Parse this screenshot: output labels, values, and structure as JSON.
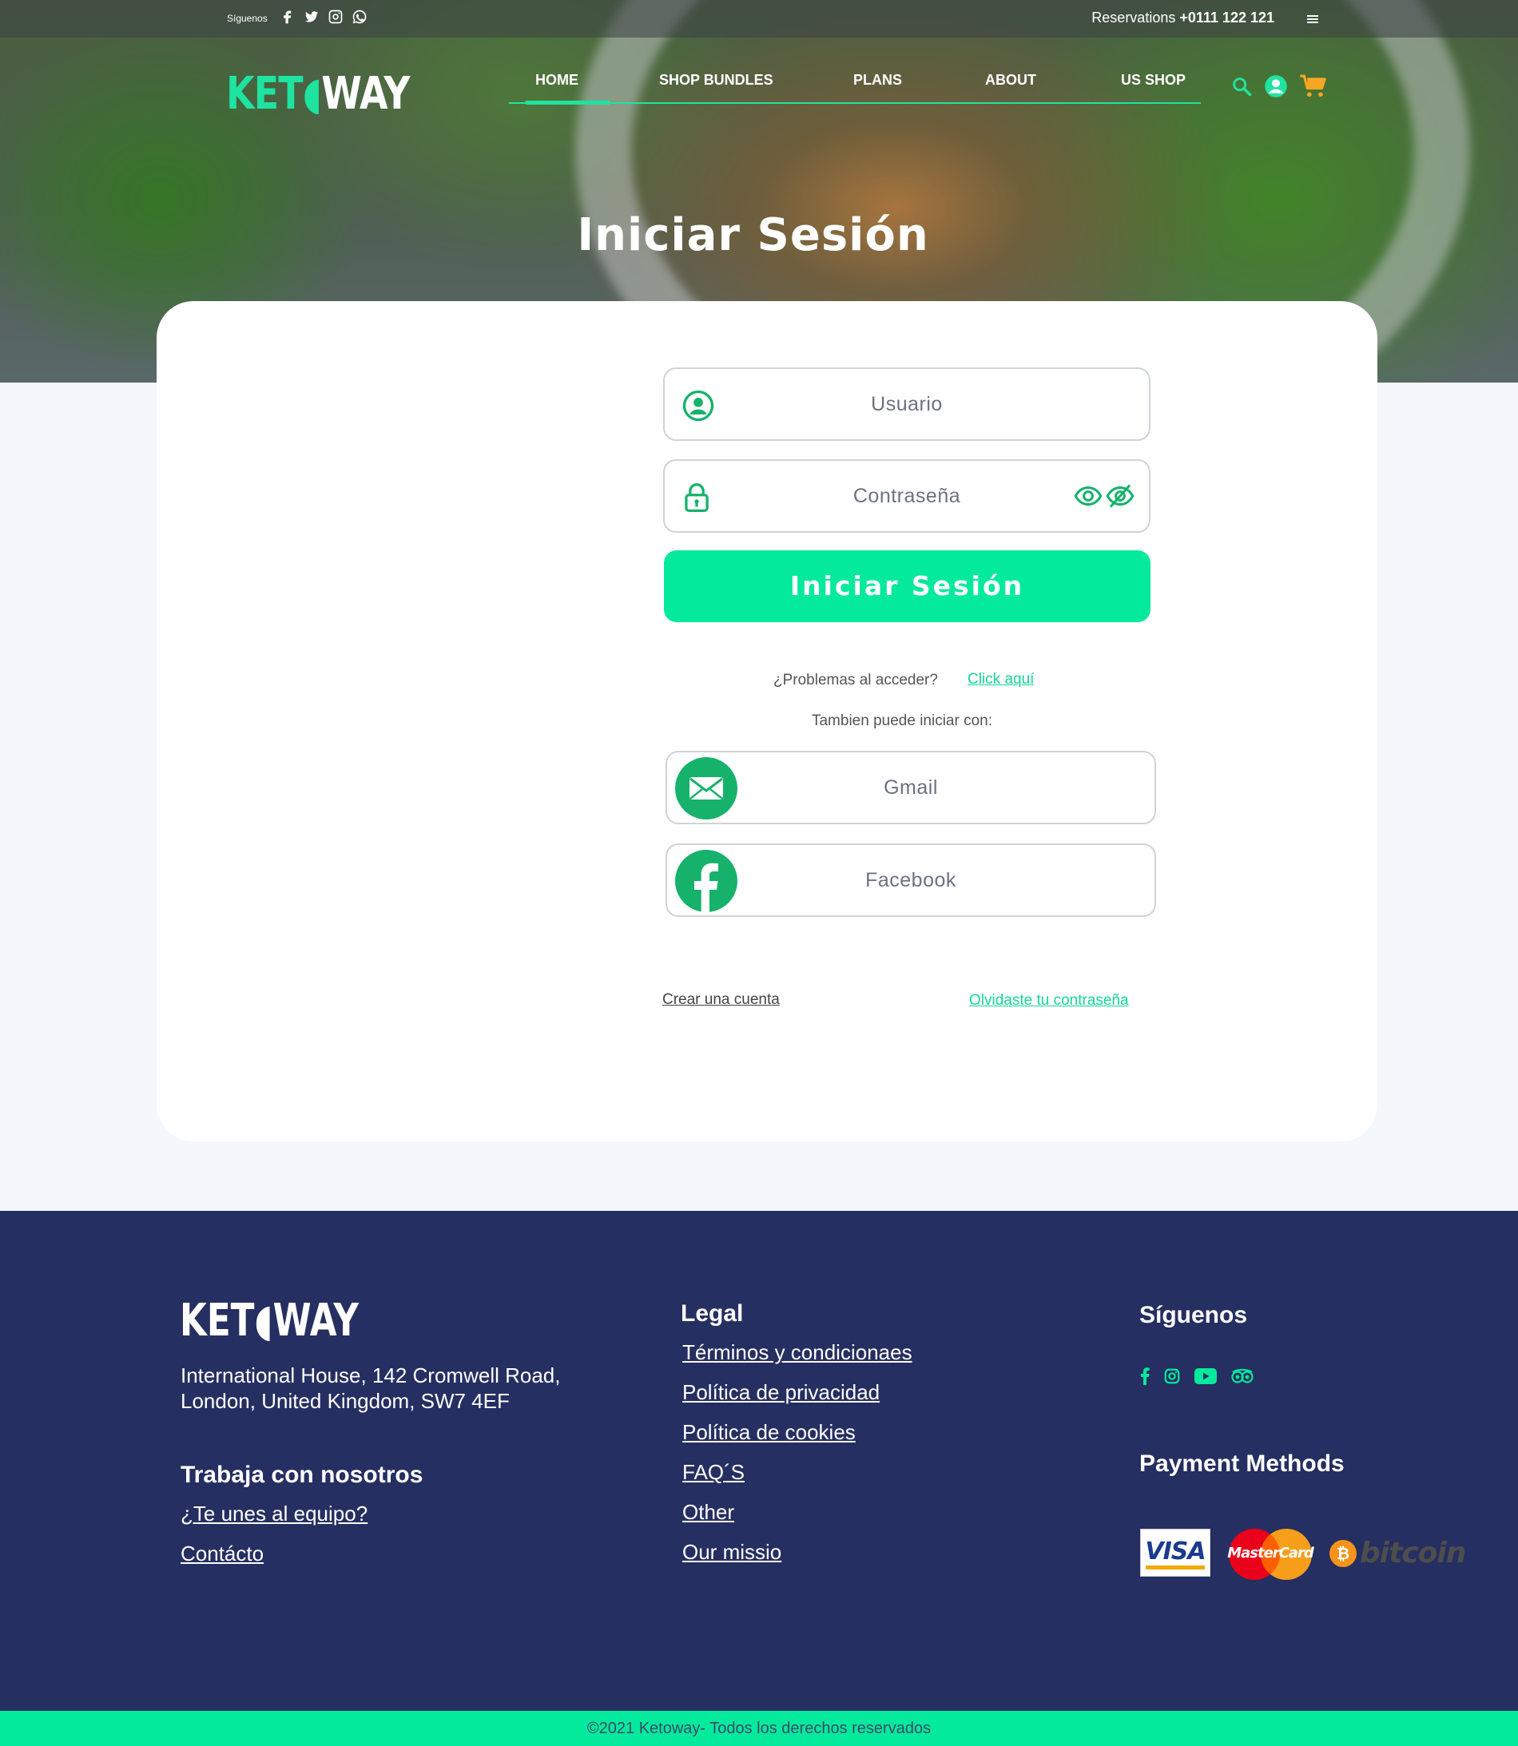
{
  "topbar": {
    "follow_label": "Síguenos",
    "reservations_label": "Reservations",
    "phone": "+0111 122 121"
  },
  "brand": {
    "logo_part1": "KET",
    "logo_part2": "WAY"
  },
  "nav": {
    "items": [
      {
        "label": "HOME"
      },
      {
        "label": "SHOP BUNDLES"
      },
      {
        "label": "PLANS"
      },
      {
        "label": "ABOUT"
      },
      {
        "label": "US SHOP"
      }
    ],
    "active_index": 0
  },
  "hero": {
    "title": "Iniciar Sesión"
  },
  "login": {
    "user_placeholder": "Usuario",
    "password_placeholder": "Contraseña",
    "submit_label": "Iniciar Sesión",
    "problem_text": "¿Problemas al acceder?",
    "problem_link": "Click aquí",
    "alt_login_text": "Tambien puede iniciar con:",
    "gmail_label": "Gmail",
    "facebook_label": "Facebook",
    "create_account": "Crear una cuenta",
    "forgot_password": "Olvidaste tu contraseña"
  },
  "footer": {
    "address_line1": "International House, 142 Cromwell Road,",
    "address_line2": "London, United Kingdom, SW7 4EF",
    "work_heading": "Trabaja con nosotros",
    "work_links": [
      "¿Te unes al equipo?",
      "Contácto"
    ],
    "legal_heading": "Legal",
    "legal_links": [
      "Términos y condicionaes",
      "Política de privacidad",
      "Política de cookies",
      "FAQ´S",
      "Other",
      "Our missio"
    ],
    "follow_heading": "Síguenos",
    "payment_heading": "Payment Methods",
    "payment_methods": [
      "VISA",
      "MasterCard",
      "bitcoin"
    ],
    "copyright": "©2021 Ketoway- Todos los derechos reservados"
  },
  "colors": {
    "accent": "#04ea9c",
    "footer_bg": "#262f61",
    "icon_green": "#16b26b"
  }
}
